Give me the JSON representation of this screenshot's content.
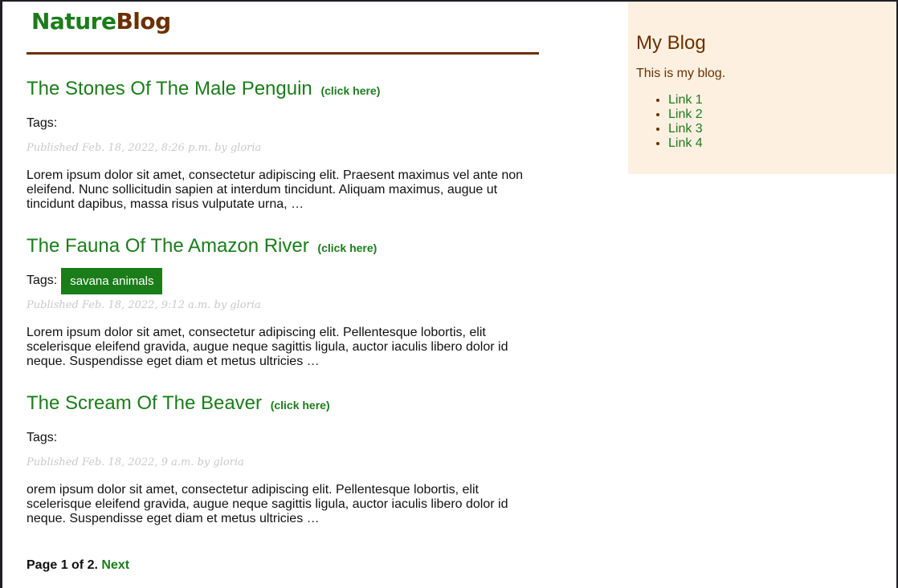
{
  "header": {
    "logo_part1": "Nature",
    "logo_part2": "Blog",
    "colors": {
      "green": "#1a7d1a",
      "brown": "#6b3000"
    }
  },
  "posts": [
    {
      "title": "The Stones Of The Male Penguin",
      "click": "(click here)",
      "tags_label": "Tags:",
      "tags": [],
      "meta": "Published Feb. 18, 2022, 8:26 p.m. by gloria",
      "excerpt": "Lorem ipsum dolor sit amet, consectetur adipiscing elit. Praesent maximus vel ante non eleifend. Nunc sollicitudin sapien at interdum tincidunt. Aliquam maximus, augue ut tincidunt dapibus, massa risus vulputate urna, …"
    },
    {
      "title": "The Fauna Of The Amazon River",
      "click": "(click here)",
      "tags_label": "Tags:",
      "tags": [
        "savana animals"
      ],
      "meta": "Published Feb. 18, 2022, 9:12 a.m. by gloria",
      "excerpt": "Lorem ipsum dolor sit amet, consectetur adipiscing elit. Pellentesque lobortis, elit scelerisque eleifend gravida, augue neque sagittis ligula, auctor iaculis libero dolor id neque. Suspendisse eget diam et metus ultricies …"
    },
    {
      "title": "The Scream Of The Beaver",
      "click": "(click here)",
      "tags_label": "Tags:",
      "tags": [],
      "meta": "Published Feb. 18, 2022, 9 a.m. by gloria",
      "excerpt": "orem ipsum dolor sit amet, consectetur adipiscing elit. Pellentesque lobortis, elit scelerisque eleifend gravida, augue neque sagittis ligula, auctor iaculis libero dolor id neque. Suspendisse eget diam et metus ultricies …"
    }
  ],
  "pagination": {
    "text": "Page 1 of 2.",
    "next": "Next"
  },
  "sidebar": {
    "title": "My Blog",
    "description": "This is my blog.",
    "links": [
      "Link 1",
      "Link 2",
      "Link 3",
      "Link 4"
    ]
  }
}
